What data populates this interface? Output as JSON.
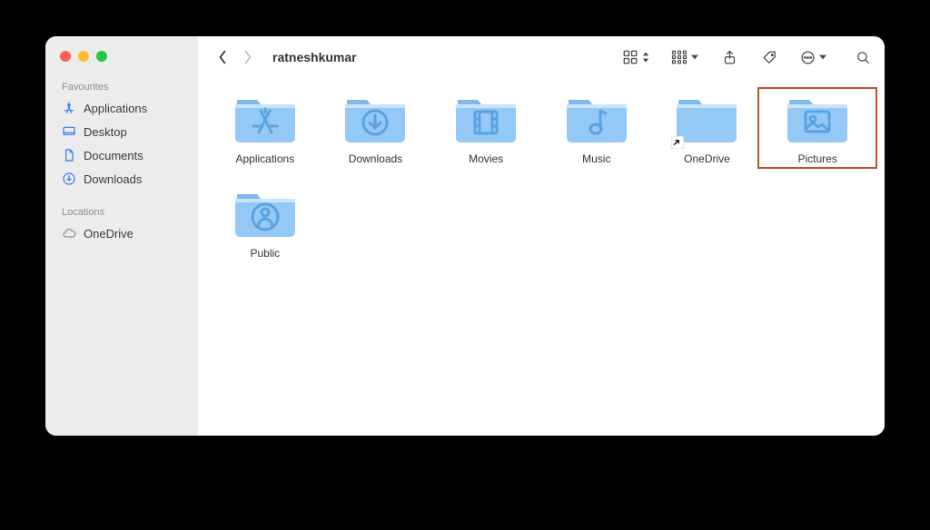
{
  "window": {
    "title": "ratneshkumar"
  },
  "sidebar": {
    "sections": [
      {
        "label": "Favourites",
        "items": [
          {
            "icon": "app-store-icon",
            "label": "Applications"
          },
          {
            "icon": "desktop-icon",
            "label": "Desktop"
          },
          {
            "icon": "document-icon",
            "label": "Documents"
          },
          {
            "icon": "download-icon",
            "label": "Downloads"
          }
        ]
      },
      {
        "label": "Locations",
        "items": [
          {
            "icon": "cloud-icon",
            "label": "OneDrive"
          }
        ]
      }
    ]
  },
  "folders": [
    {
      "name": "Applications",
      "glyph": "appstore",
      "alias": false,
      "highlight": false
    },
    {
      "name": "Downloads",
      "glyph": "download",
      "alias": false,
      "highlight": false
    },
    {
      "name": "Movies",
      "glyph": "film",
      "alias": false,
      "highlight": false
    },
    {
      "name": "Music",
      "glyph": "music",
      "alias": false,
      "highlight": false
    },
    {
      "name": "OneDrive",
      "glyph": "none",
      "alias": true,
      "highlight": false
    },
    {
      "name": "Pictures",
      "glyph": "picture",
      "alias": false,
      "highlight": true
    },
    {
      "name": "Public",
      "glyph": "person",
      "alias": false,
      "highlight": false
    }
  ],
  "colors": {
    "folder_base": "#94c9f6",
    "folder_tab": "#7fb9ec",
    "folder_glyph": "#5aa3e0",
    "highlight_box": "#c94a2c",
    "sidebar_accent": "#2c7bf2"
  }
}
